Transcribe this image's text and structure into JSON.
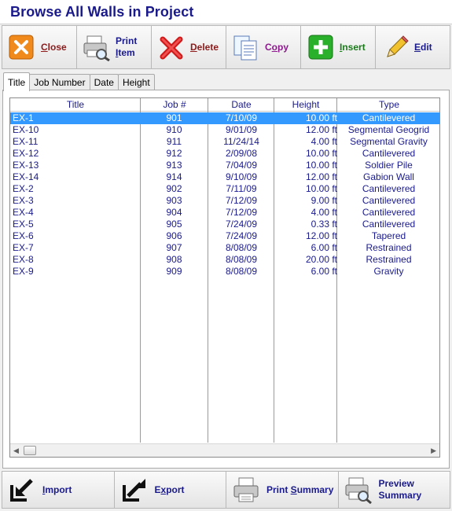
{
  "window": {
    "title": "Browse All Walls in Project"
  },
  "toolbar": {
    "close": {
      "prefix": "",
      "key": "C",
      "rest": "lose",
      "color": "#8c1a1a",
      "icon": "close-icon"
    },
    "print_item": {
      "line1": "Print",
      "line2_key": "I",
      "line2_rest": "tem",
      "color": "#1a1a8c",
      "icon": "printer-magnifier-icon"
    },
    "delete": {
      "key": "D",
      "rest": "elete",
      "color": "#8c1a1a",
      "icon": "delete-x-icon"
    },
    "copy": {
      "key": "",
      "prefix": "C",
      "key2": "o",
      "rest": "py",
      "color": "#8c1a8c",
      "icon": "copy-pages-icon"
    },
    "insert": {
      "key": "I",
      "rest": "nsert",
      "color": "#1a7a1a",
      "icon": "insert-plus-icon"
    },
    "edit": {
      "key": "E",
      "rest": "dit",
      "color": "#1a1a8c",
      "icon": "pencil-icon"
    }
  },
  "tabs": [
    "Title",
    "Job Number",
    "Date",
    "Height"
  ],
  "active_tab": "Title",
  "table": {
    "columns": [
      "Title",
      "Job #",
      "Date",
      "Height",
      "Type"
    ],
    "rows": [
      [
        "EX-1",
        "901",
        "7/10/09",
        "10.00 ft",
        "Cantilevered"
      ],
      [
        "EX-10",
        "910",
        "9/01/09",
        "12.00 ft",
        "Segmental Geogrid"
      ],
      [
        "EX-11",
        "911",
        "11/24/14",
        "4.00 ft",
        "Segmental Gravity"
      ],
      [
        "EX-12",
        "912",
        "2/09/08",
        "10.00 ft",
        "Cantilevered"
      ],
      [
        "EX-13",
        "913",
        "7/04/09",
        "10.00 ft",
        "Soldier Pile"
      ],
      [
        "EX-14",
        "914",
        "9/10/09",
        "12.00 ft",
        "Gabion Wall"
      ],
      [
        "EX-2",
        "902",
        "7/11/09",
        "10.00 ft",
        "Cantilevered"
      ],
      [
        "EX-3",
        "903",
        "7/12/09",
        "9.00 ft",
        "Cantilevered"
      ],
      [
        "EX-4",
        "904",
        "7/12/09",
        "4.00 ft",
        "Cantilevered"
      ],
      [
        "EX-5",
        "905",
        "7/24/09",
        "0.33 ft",
        "Cantilevered"
      ],
      [
        "EX-6",
        "906",
        "7/24/09",
        "12.00 ft",
        "Tapered"
      ],
      [
        "EX-7",
        "907",
        "8/08/09",
        "6.00 ft",
        "Restrained"
      ],
      [
        "EX-8",
        "908",
        "8/08/09",
        "20.00 ft",
        "Restrained"
      ],
      [
        "EX-9",
        "909",
        "8/08/09",
        "6.00 ft",
        "Gravity"
      ]
    ],
    "selected_row": 0
  },
  "bottombar": {
    "import": {
      "key": "I",
      "rest": "mport",
      "icon": "import-arrow-icon"
    },
    "export": {
      "prefix": "E",
      "key": "x",
      "rest": "port",
      "icon": "export-arrow-icon"
    },
    "print_summary": {
      "prefix": "Print ",
      "key": "S",
      "rest": "ummary",
      "icon": "printer-icon"
    },
    "preview_summary": {
      "line1": "Preview",
      "line2": "Summary",
      "icon": "printer-magnifier-icon"
    }
  },
  "colors": {
    "title": "#1a1a8c",
    "selection": "#3399ff",
    "cell_text": "#1a1a8c"
  }
}
